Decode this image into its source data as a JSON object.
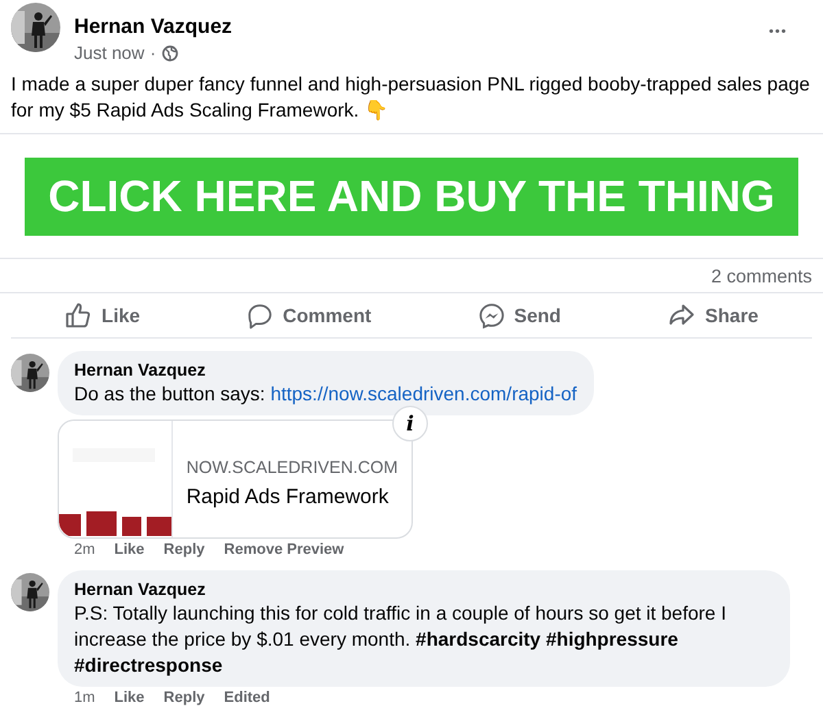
{
  "post": {
    "author": "Hernan Vazquez",
    "time": "Just now",
    "separator": "·",
    "text": "I made a super duper fancy funnel and high-persuasion PNL rigged booby-trapped sales page for my $5 Rapid Ads Scaling Framework. 👇",
    "banner": "CLICK HERE AND BUY THE THING",
    "more": "•••",
    "comment_count": "2 comments"
  },
  "actions": [
    {
      "kind": "like",
      "label": "Like"
    },
    {
      "kind": "comment",
      "label": "Comment"
    },
    {
      "kind": "send",
      "label": "Send"
    },
    {
      "kind": "share",
      "label": "Share"
    }
  ],
  "comments": [
    {
      "author": "Hernan Vazquez",
      "text": "Do as the button says: ",
      "link": "https://now.scaledriven.com/rapid-of",
      "preview": {
        "kind": "picture",
        "domain": "NOW.SCALEDRIVEN.COM",
        "title": "Rapid Ads Framework",
        "info": "i"
      },
      "time": "2m",
      "links": [
        "Like",
        "Reply",
        "Remove Preview"
      ]
    },
    {
      "author": "Hernan Vazquez",
      "text": "P.S: Totally launching this for cold traffic in a couple of hours so get it before I increase the price by $.01 every month. **#hardscarcity #highpressure #directresponse**",
      "time": "1m",
      "links": [
        "Like",
        "Reply"
      ],
      "note": "Edited"
    }
  ]
}
